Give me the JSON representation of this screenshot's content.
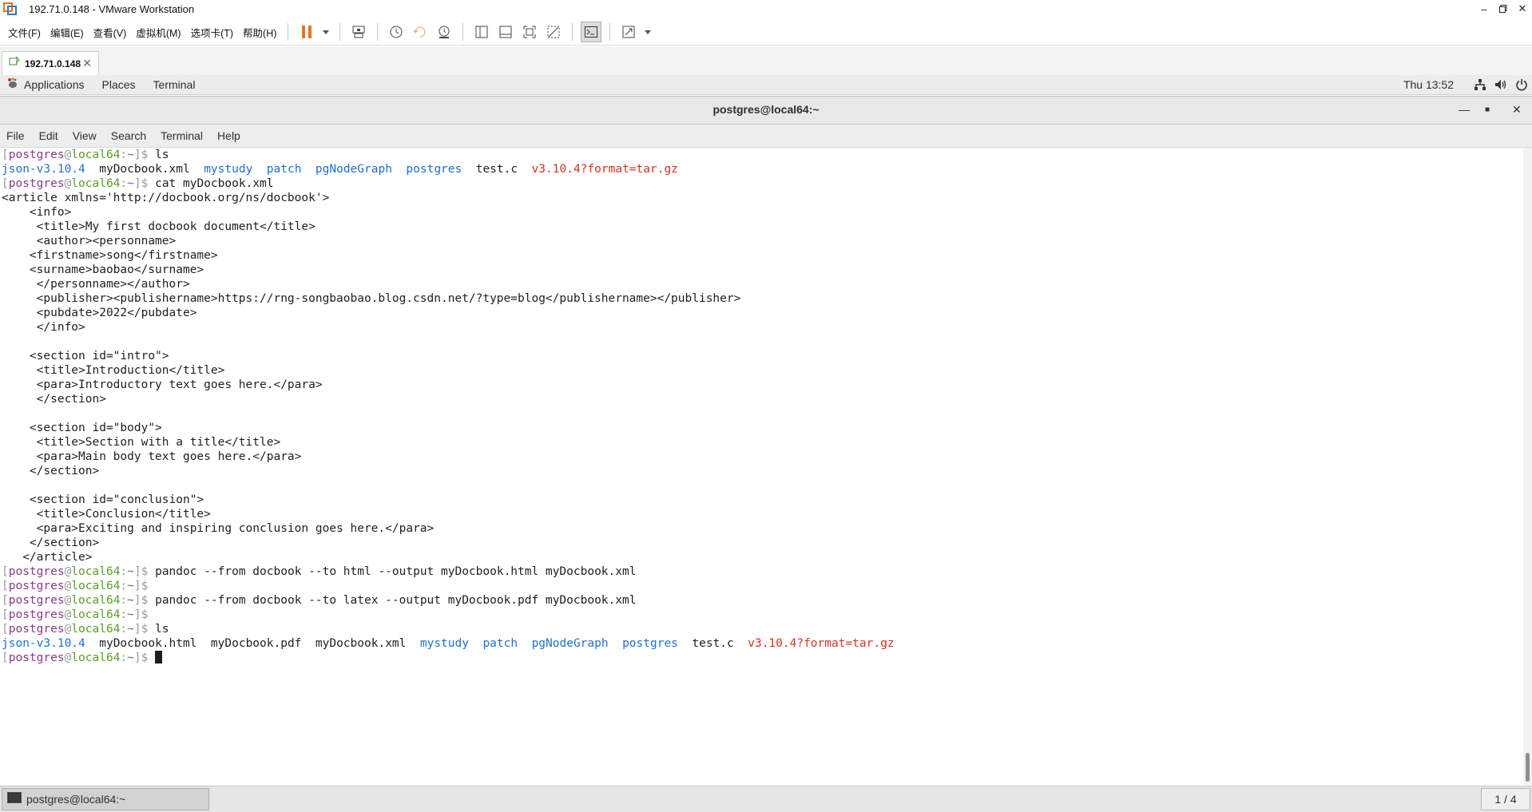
{
  "vmware": {
    "window_title": "192.71.0.148 - VMware Workstation",
    "menus": [
      "文件(F)",
      "编辑(E)",
      "查看(V)",
      "虚拟机(M)",
      "选项卡(T)",
      "帮助(H)"
    ],
    "tab_label": "192.71.0.148",
    "accent_color": "#e8741a"
  },
  "gnome": {
    "menus": [
      "Applications",
      "Places",
      "Terminal"
    ],
    "clock": "Thu 13:52"
  },
  "terminal": {
    "title": "postgres@local64:~",
    "menus": [
      "File",
      "Edit",
      "View",
      "Search",
      "Terminal",
      "Help"
    ],
    "prompt": {
      "user": "postgres",
      "at": "@",
      "host": "local64",
      "path": "~",
      "sep": ":",
      "open": "[",
      "close": "]$"
    },
    "commands": {
      "ls1": "ls",
      "cat": "cat myDocbook.xml",
      "pandoc_html": "pandoc --from docbook --to html --output myDocbook.html myDocbook.xml",
      "pandoc_pdf": "pandoc --from docbook --to latex --output myDocbook.pdf myDocbook.xml",
      "ls2": "ls"
    },
    "ls1_output": [
      {
        "name": "json-v3.10.4",
        "type": "dir"
      },
      {
        "name": "myDocbook.xml",
        "type": "file"
      },
      {
        "name": "mystudy",
        "type": "dir"
      },
      {
        "name": "patch",
        "type": "dir"
      },
      {
        "name": "pgNodeGraph",
        "type": "dir"
      },
      {
        "name": "postgres",
        "type": "dir"
      },
      {
        "name": "test.c",
        "type": "file"
      },
      {
        "name": "v3.10.4?format=tar.gz",
        "type": "archive"
      }
    ],
    "cat_output": [
      "<article xmlns='http://docbook.org/ns/docbook'>",
      "    <info>",
      "     <title>My first docbook document</title>",
      "     <author><personname>",
      "    <firstname>song</firstname>",
      "    <surname>baobao</surname>",
      "     </personname></author>",
      "     <publisher><publishername>https://rng-songbaobao.blog.csdn.net/?type=blog</publishername></publisher>",
      "     <pubdate>2022</pubdate>",
      "     </info>",
      "",
      "    <section id=\"intro\">",
      "     <title>Introduction</title>",
      "     <para>Introductory text goes here.</para>",
      "     </section>",
      "",
      "    <section id=\"body\">",
      "     <title>Section with a title</title>",
      "     <para>Main body text goes here.</para>",
      "    </section>",
      "",
      "    <section id=\"conclusion\">",
      "     <title>Conclusion</title>",
      "     <para>Exciting and inspiring conclusion goes here.</para>",
      "    </section>",
      "   </article>"
    ],
    "ls2_output": [
      {
        "name": "json-v3.10.4",
        "type": "dir"
      },
      {
        "name": "myDocbook.html",
        "type": "file"
      },
      {
        "name": "myDocbook.pdf",
        "type": "file"
      },
      {
        "name": "myDocbook.xml",
        "type": "file"
      },
      {
        "name": "mystudy",
        "type": "dir"
      },
      {
        "name": "patch",
        "type": "dir"
      },
      {
        "name": "pgNodeGraph",
        "type": "dir"
      },
      {
        "name": "postgres",
        "type": "dir"
      },
      {
        "name": "test.c",
        "type": "file"
      },
      {
        "name": "v3.10.4?format=tar.gz",
        "type": "archive"
      }
    ]
  },
  "taskbar": {
    "task_label": "postgres@local64:~",
    "workspace": "1 / 4"
  }
}
